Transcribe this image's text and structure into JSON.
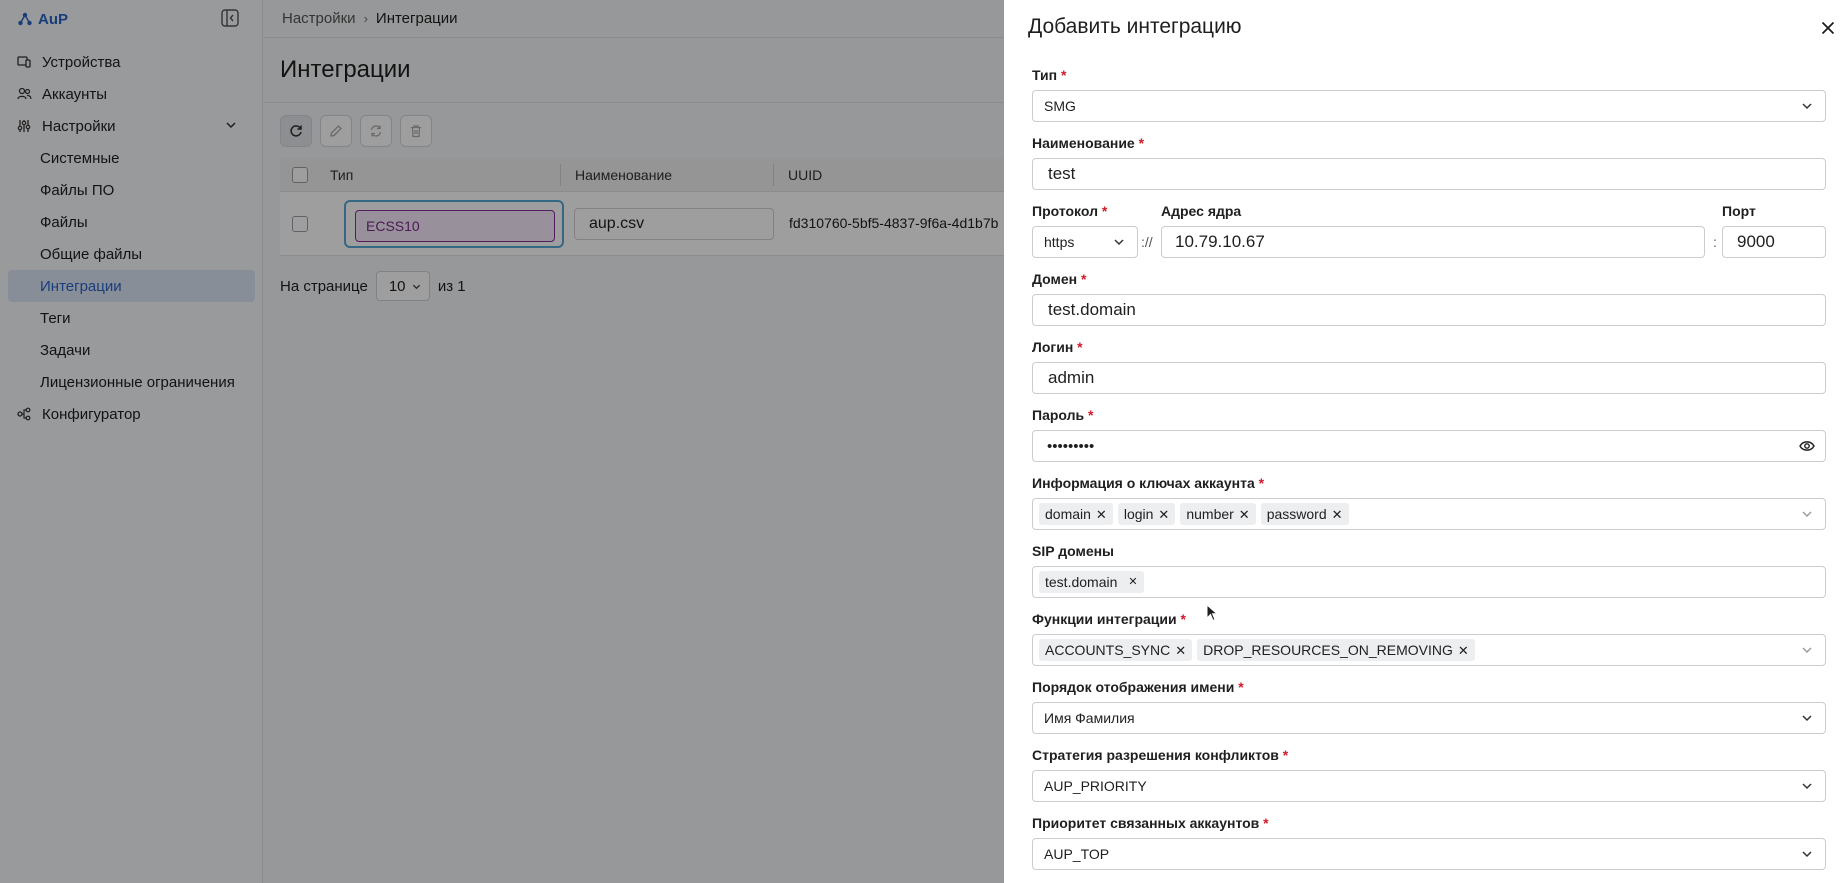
{
  "sidebar": {
    "brand": "AuP",
    "items": [
      {
        "label": "Устройства"
      },
      {
        "label": "Аккаунты"
      },
      {
        "label": "Настройки"
      },
      {
        "label": "Системные"
      },
      {
        "label": "Файлы ПО"
      },
      {
        "label": "Файлы"
      },
      {
        "label": "Общие файлы"
      },
      {
        "label": "Интеграции"
      },
      {
        "label": "Теги"
      },
      {
        "label": "Задачи"
      },
      {
        "label": "Лицензионные ограничения"
      },
      {
        "label": "Конфигуратор"
      }
    ]
  },
  "breadcrumb": {
    "parent": "Настройки",
    "sep": "›",
    "current": "Интеграции"
  },
  "page": {
    "title": "Интеграции"
  },
  "table": {
    "headers": {
      "type": "Тип",
      "name": "Наименование",
      "uuid": "UUID"
    },
    "row": {
      "type": "ECSS10",
      "name": "aup.csv",
      "uuid": "fd310760-5bf5-4837-9f6a-4d1b7b"
    }
  },
  "pager": {
    "label": "На странице",
    "size": "10",
    "of": "из 1"
  },
  "drawer": {
    "title": "Добавить интеграцию",
    "fields": {
      "type": {
        "label": "Тип",
        "value": "SMG"
      },
      "name": {
        "label": "Наименование",
        "value": "test"
      },
      "protocol": {
        "label": "Протокол",
        "value": "https"
      },
      "scheme_sep": "://",
      "host": {
        "label": "Адрес ядра",
        "value": "10.79.10.67"
      },
      "port_sep": ":",
      "port": {
        "label": "Порт",
        "value": "9000"
      },
      "domain": {
        "label": "Домен",
        "value": "test.domain"
      },
      "login": {
        "label": "Логин",
        "value": "admin"
      },
      "password": {
        "label": "Пароль",
        "value": "•••••••••"
      },
      "account_keys": {
        "label": "Информация о ключах аккаунта",
        "tags": [
          "domain",
          "login",
          "number",
          "password"
        ]
      },
      "sip_domains": {
        "label": "SIP домены",
        "tags": [
          "test.domain"
        ]
      },
      "functions": {
        "label": "Функции интеграции",
        "tags": [
          "ACCOUNTS_SYNC",
          "DROP_RESOURCES_ON_REMOVING"
        ]
      },
      "name_order": {
        "label": "Порядок отображения имени",
        "value": "Имя Фамилия"
      },
      "conflict": {
        "label": "Стратегия разрешения конфликтов",
        "value": "AUP_PRIORITY"
      },
      "priority": {
        "label": "Приоритет связанных аккаунтов",
        "value": "AUP_TOP"
      }
    },
    "required_mark": "*"
  },
  "colors": {
    "accent": "#2a63c7",
    "required": "#d11a2a",
    "edit_border": "#57a8d6",
    "edit_cell": "#8a2f9a"
  }
}
